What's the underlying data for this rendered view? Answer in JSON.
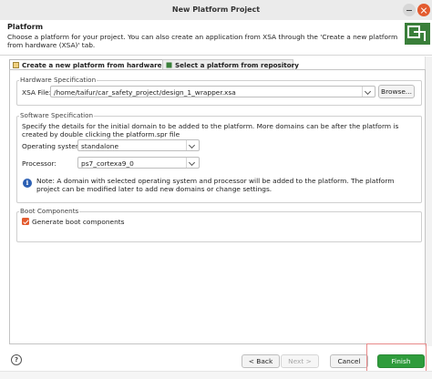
{
  "window": {
    "title": "New Platform Project"
  },
  "banner": {
    "title": "Platform",
    "description": "Choose a platform for your project. You can also create an application from XSA through the 'Create a new platform from hardware (XSA)' tab."
  },
  "tabs": [
    {
      "label": "Create a new platform from hardware (XSA)",
      "active": true
    },
    {
      "label": "Select a platform from repository",
      "active": false
    }
  ],
  "hardware": {
    "group_title": "Hardware Specification",
    "xsa_label": "XSA File:",
    "xsa_value": "/home/taifur/car_safety_project/design_1_wrapper.xsa",
    "browse_label": "Browse..."
  },
  "software": {
    "group_title": "Software Specification",
    "description": "Specify the details for the initial domain to be added to the platform. More domains can be after the platform is created by double clicking the platform.spr file",
    "os_label": "Operating system:",
    "os_value": "standalone",
    "processor_label": "Processor:",
    "processor_value": "ps7_cortexa9_0",
    "note": "Note: A domain with selected operating system and processor will be added to the platform. The platform project can be modified later to add new domains or change settings."
  },
  "boot": {
    "group_title": "Boot Components",
    "checkbox_label": "Generate boot components",
    "checked": true
  },
  "buttons": {
    "help": "?",
    "back": "< Back",
    "next": "Next >",
    "cancel": "Cancel",
    "finish": "Finish"
  },
  "colors": {
    "accent_orange": "#e35b2f",
    "finish_green": "#2f9c3c",
    "info_blue": "#2b5fb3"
  }
}
